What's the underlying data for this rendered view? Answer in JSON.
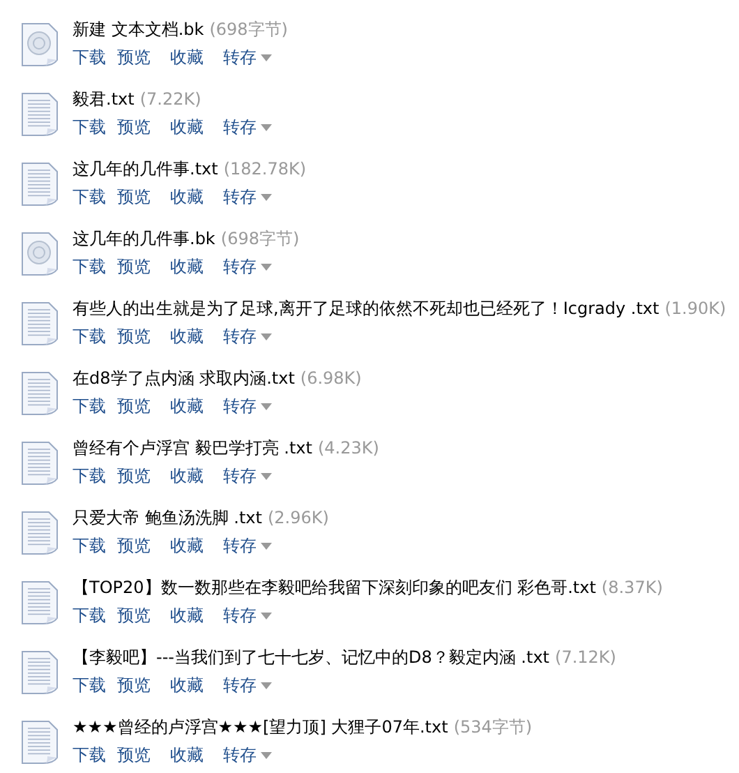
{
  "files": [
    {
      "kind": "bk",
      "name": "新建 文本文档.bk",
      "size": "(698字节)",
      "actions": [
        "下载",
        "预览",
        "收藏",
        "转存"
      ]
    },
    {
      "kind": "txt",
      "name": "毅君.txt",
      "size": "(7.22K)",
      "actions": [
        "下载",
        "预览",
        "收藏",
        "转存"
      ]
    },
    {
      "kind": "txt",
      "name": "这几年的几件事.txt",
      "size": "(182.78K)",
      "actions": [
        "下载",
        "预览",
        "收藏",
        "转存"
      ]
    },
    {
      "kind": "bk",
      "name": "这几年的几件事.bk",
      "size": "(698字节)",
      "actions": [
        "下载",
        "预览",
        "收藏",
        "转存"
      ]
    },
    {
      "kind": "txt",
      "name": "有些人的出生就是为了足球,离开了足球的依然不死却也已经死了！Icgrady .txt",
      "size": "(1.90K)",
      "actions": [
        "下载",
        "预览",
        "收藏",
        "转存"
      ]
    },
    {
      "kind": "txt",
      "name": "在d8学了点内涵 求取内涵.txt",
      "size": "(6.98K)",
      "actions": [
        "下载",
        "预览",
        "收藏",
        "转存"
      ]
    },
    {
      "kind": "txt",
      "name": "曾经有个卢浮宫 毅巴学打亮 .txt",
      "size": "(4.23K)",
      "actions": [
        "下载",
        "预览",
        "收藏",
        "转存"
      ]
    },
    {
      "kind": "txt",
      "name": "只爱大帝 鲍鱼汤洗脚 .txt",
      "size": "(2.96K)",
      "actions": [
        "下载",
        "预览",
        "收藏",
        "转存"
      ]
    },
    {
      "kind": "txt",
      "name": "【TOP20】数一数那些在李毅吧给我留下深刻印象的吧友们 彩色哥.txt",
      "size": "(8.37K)",
      "actions": [
        "下载",
        "预览",
        "收藏",
        "转存"
      ]
    },
    {
      "kind": "txt",
      "name": "【李毅吧】---当我们到了七十七岁、记忆中的D8？毅定内涵 .txt",
      "size": "(7.12K)",
      "actions": [
        "下载",
        "预览",
        "收藏",
        "转存"
      ]
    },
    {
      "kind": "txt",
      "name": "★★★曾经的卢浮宫★★★[望力顶] 大狸子07年.txt",
      "size": "(534字节)",
      "actions": [
        "下载",
        "预览",
        "收藏",
        "转存"
      ]
    }
  ]
}
